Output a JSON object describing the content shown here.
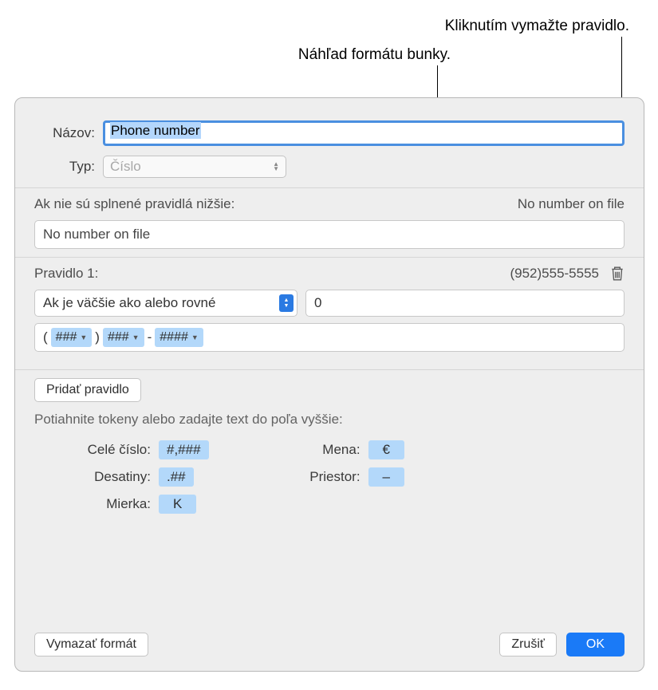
{
  "callouts": {
    "delete": "Kliknutím vymažte pravidlo.",
    "preview": "Náhľad formátu bunky."
  },
  "labels": {
    "name": "Názov:",
    "type": "Typ:"
  },
  "name_value": "Phone number",
  "type_value": "Číslo",
  "no_rules": {
    "label": "Ak nie sú splnené pravidlá nižšie:",
    "preview": "No number on file",
    "value": "No number on file"
  },
  "rule1": {
    "label": "Pravidlo 1:",
    "preview": "(952)555-5555",
    "condition": "Ak je väčšie ako alebo rovné",
    "value": "0",
    "tokens": [
      "###",
      "###",
      "####"
    ]
  },
  "buttons": {
    "add_rule": "Pridať pravidlo",
    "clear_format": "Vymazať formát",
    "cancel": "Zrušiť",
    "ok": "OK"
  },
  "instructions": "Potiahnite tokeny alebo zadajte text do poľa vyššie:",
  "tokens": {
    "whole": {
      "label": "Celé číslo:",
      "value": "#,###"
    },
    "decimals": {
      "label": "Desatiny:",
      "value": ".##"
    },
    "scale": {
      "label": "Mierka:",
      "value": "K"
    },
    "currency": {
      "label": "Mena:",
      "value": "€"
    },
    "space": {
      "label": "Priestor:",
      "value": "–"
    }
  }
}
